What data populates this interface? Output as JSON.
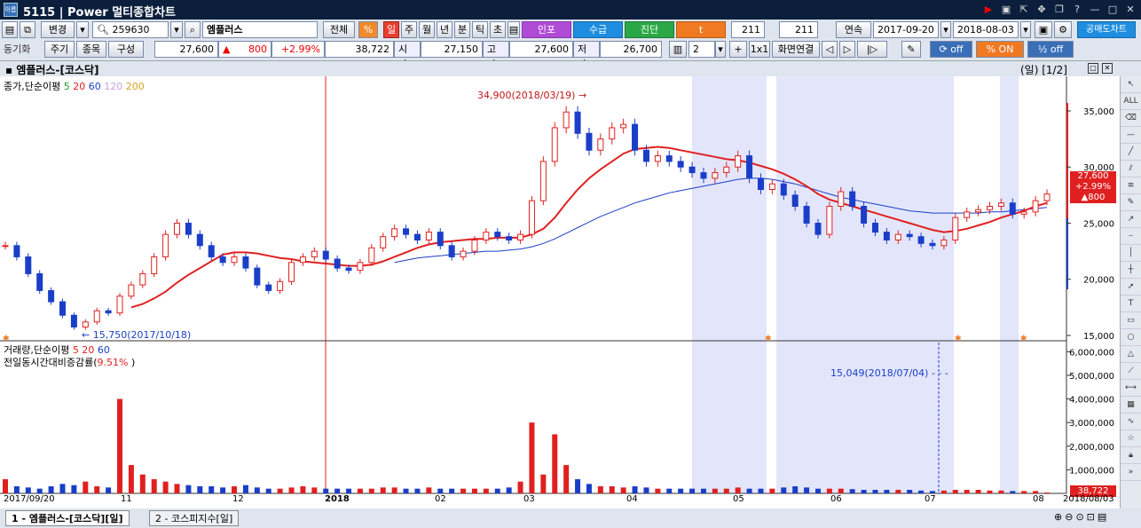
{
  "window": {
    "screen_no": "5115",
    "title": "Power 멀티종합차트"
  },
  "toolbar": {
    "change_label": "변경",
    "code": "259630",
    "name": "엠플러스",
    "all_label": "전체",
    "percent_icon": "%",
    "periods": [
      "일",
      "주",
      "월",
      "년",
      "분",
      "틱",
      "초"
    ],
    "btn_investor": "인포",
    "btn_supply": "수급",
    "btn_diag": "진단",
    "btn_t": "t",
    "count1": "211",
    "count2": "211",
    "continuous_label": "연속",
    "date_from": "2017-09-20",
    "date_to": "2018-08-03",
    "short_label": "공매도차트",
    "sync_label": "동기화",
    "period_label": "주기",
    "item_label": "종목",
    "config_label": "구성",
    "price": "27,600",
    "change": "800",
    "change_pct": "+2.99%",
    "volume": "38,722",
    "open_label": "시가",
    "open": "27,150",
    "high_label": "고가",
    "high": "27,600",
    "low_label": "저가",
    "low": "26,700",
    "layout_count": "2",
    "layout_1x1": "1x1",
    "screen_link": "화면연결",
    "off1": "off",
    "on_label": "ON",
    "off2": "off"
  },
  "chart_header": {
    "title": "엠플러스-[코스닥]",
    "page": "(일) [1/2]"
  },
  "price_legend": {
    "label": "종가,단순이평",
    "ma": [
      "5",
      "20",
      "60",
      "120",
      "200"
    ]
  },
  "volume_legend": {
    "label": "거래량,단순이평",
    "ma": [
      "5",
      "20",
      "60"
    ],
    "sub": "전일동시간대비증감률(",
    "sub_pct": "9.51%"
  },
  "annotations": {
    "high": "34,900(2018/03/19)",
    "low": "15,750(2017/10/18)",
    "vol_peak": "15,049(2018/07/04)"
  },
  "price_box": {
    "price": "27,600",
    "pct": "+2.99%",
    "chg": "▲800"
  },
  "vol_box": "38,722",
  "tabs": [
    "1 - 엠플러스-[코스닥][일]",
    "2 - 코스피지수[일]"
  ],
  "chart_data": {
    "type": "line",
    "x_axis": [
      "2017/09/20",
      "11",
      "12",
      "2018",
      "02",
      "03",
      "04",
      "05",
      "06",
      "07",
      "08",
      "2018/08/03"
    ],
    "price_axis": {
      "ticks": [
        "35,000",
        "30,000",
        "25,000",
        "20,000",
        "15,000"
      ],
      "ylim": [
        15000,
        36500
      ]
    },
    "volume_axis": {
      "ticks": [
        "6,000,000",
        "5,000,000",
        "4,000,000",
        "3,000,000",
        "2,000,000",
        "1,000,000"
      ]
    },
    "close_series": [
      23000,
      22000,
      20500,
      19000,
      18000,
      16800,
      15750,
      16200,
      17200,
      17000,
      18500,
      19500,
      20500,
      22000,
      24000,
      25000,
      24000,
      23000,
      22000,
      21500,
      22000,
      21000,
      19500,
      19000,
      19800,
      21500,
      22000,
      22500,
      21800,
      21000,
      20800,
      21500,
      22800,
      23800,
      24500,
      24000,
      23500,
      24200,
      23000,
      22000,
      22500,
      23500,
      24200,
      23800,
      23500,
      24000,
      27000,
      30500,
      33500,
      34900,
      33000,
      31500,
      32500,
      33500,
      33800,
      31500,
      30500,
      31000,
      30500,
      30000,
      29500,
      29000,
      29500,
      30000,
      31000,
      29000,
      28000,
      28500,
      27500,
      26500,
      25000,
      24000,
      26500,
      27800,
      26500,
      25000,
      24200,
      23500,
      24000,
      23800,
      23200,
      23000,
      23500,
      25500,
      26000,
      26200,
      26500,
      26800,
      25800,
      26000,
      27000,
      27600
    ],
    "ma20": [
      null,
      null,
      null,
      null,
      null,
      null,
      null,
      null,
      null,
      null,
      null,
      17500,
      17800,
      18300,
      18900,
      19700,
      20400,
      21000,
      21600,
      22200,
      22400,
      22400,
      22300,
      22100,
      21900,
      21800,
      21600,
      21500,
      21400,
      21300,
      21200,
      21200,
      21300,
      21600,
      22000,
      22400,
      22800,
      23100,
      23300,
      23400,
      23500,
      23600,
      23600,
      23700,
      23700,
      23700,
      24000,
      24500,
      25500,
      26800,
      28000,
      29000,
      29800,
      30500,
      31200,
      31600,
      31700,
      31800,
      31700,
      31500,
      31300,
      31100,
      30900,
      30700,
      30600,
      30400,
      30100,
      29800,
      29400,
      28900,
      28300,
      27600,
      27100,
      26800,
      26500,
      26200,
      25900,
      25600,
      25300,
      25000,
      24700,
      24400,
      24200,
      24300,
      24500,
      24800,
      25100,
      25500,
      25800,
      26100,
      26500,
      26800
    ],
    "ma60": [
      null,
      null,
      null,
      null,
      null,
      null,
      null,
      null,
      null,
      null,
      null,
      null,
      null,
      null,
      null,
      null,
      null,
      null,
      null,
      null,
      null,
      null,
      null,
      null,
      null,
      null,
      null,
      null,
      null,
      null,
      null,
      null,
      null,
      null,
      21500,
      21700,
      21900,
      22000,
      22100,
      22200,
      22300,
      22400,
      22500,
      22500,
      22600,
      22700,
      22900,
      23200,
      23600,
      24100,
      24600,
      25100,
      25600,
      26000,
      26400,
      26800,
      27100,
      27400,
      27700,
      27900,
      28100,
      28300,
      28500,
      28700,
      28900,
      29000,
      29000,
      28900,
      28700,
      28500,
      28200,
      27900,
      27600,
      27300,
      27100,
      26900,
      26700,
      26500,
      26300,
      26100,
      26000,
      25900,
      25900,
      25900,
      25900,
      25900,
      26000,
      26000,
      26100,
      26200,
      26300,
      26400
    ],
    "volume": [
      600000,
      300000,
      250000,
      200000,
      300000,
      400000,
      350000,
      500000,
      300000,
      250000,
      4000000,
      1200000,
      800000,
      600000,
      500000,
      400000,
      350000,
      300000,
      300000,
      250000,
      300000,
      350000,
      250000,
      200000,
      200000,
      250000,
      300000,
      250000,
      200000,
      200000,
      200000,
      200000,
      200000,
      250000,
      250000,
      200000,
      200000,
      250000,
      200000,
      200000,
      200000,
      200000,
      200000,
      200000,
      250000,
      500000,
      3000000,
      800000,
      2500000,
      1200000,
      600000,
      400000,
      300000,
      300000,
      250000,
      300000,
      250000,
      200000,
      200000,
      200000,
      200000,
      200000,
      200000,
      200000,
      250000,
      200000,
      200000,
      200000,
      250000,
      300000,
      250000,
      200000,
      200000,
      200000,
      180000,
      150000,
      150000,
      150000,
      150000,
      150000,
      120000,
      100000,
      120000,
      150000,
      150000,
      150000,
      120000,
      120000,
      100000,
      100000,
      100000,
      38722
    ]
  }
}
